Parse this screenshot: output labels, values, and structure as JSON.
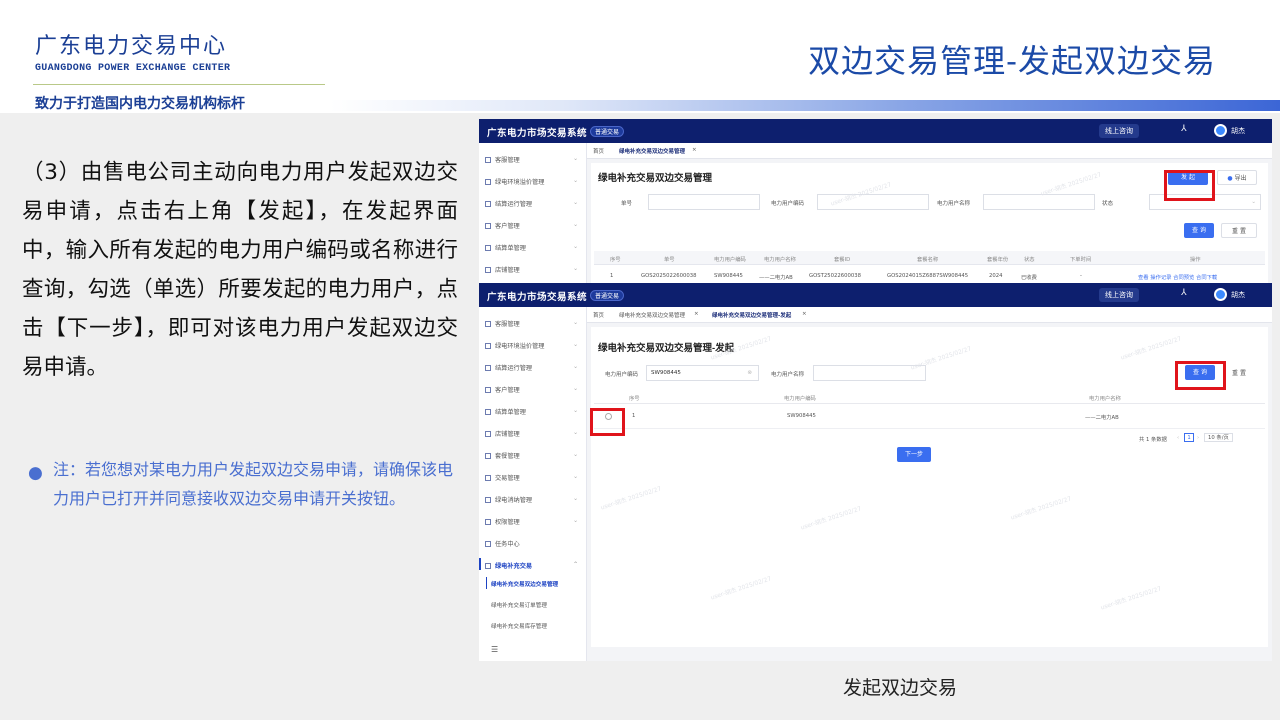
{
  "header": {
    "org_name": "广东电力交易中心",
    "org_name_en": "GUANGDONG POWER EXCHANGE CENTER",
    "slogan": "致力于打造国内电力交易机构标杆",
    "slide_title": "双边交易管理-发起双边交易"
  },
  "left": {
    "paragraph": "（3）由售电公司主动向电力用户发起双边交易申请，点击右上角【发起】，在发起界面中，输入所有发起的电力用户编码或名称进行查询，勾选（单选）所要发起的电力用户，点击【下一步】，即可对该电力用户发起双边交易申请。",
    "note": "注：若您想对某电力用户发起双边交易申请，请确保该电力用户已打开并同意接收双边交易申请开关按钮。"
  },
  "caption": "发起双边交易",
  "app": {
    "brand": "广东电力市场交易系统",
    "badge": "普通交易",
    "online": "线上咨询",
    "user": "胡杰",
    "watermark": "user-胡杰 2025/02/27",
    "sidebar1": [
      "客服管理",
      "绿电环境溢价管理",
      "结算运行管理",
      "客户管理",
      "结算单管理",
      "店铺管理"
    ],
    "sidebar2": [
      "客服管理",
      "绿电环境溢价管理",
      "结算运行管理",
      "客户管理",
      "结算单管理",
      "店铺管理",
      "套餐管理",
      "交易管理",
      "绿电消纳管理",
      "权限管理",
      "任务中心",
      "绿电补充交易"
    ],
    "sidebar2_sub": [
      "绿电补充交易双边交易管理",
      "绿电补充交易订单管理",
      "绿电补充交易库存管理"
    ],
    "shot1": {
      "tab_home": "首页",
      "tab_active": "绿电补充交易双边交易管理",
      "title": "绿电补充交易双边交易管理",
      "btn_initiate": "发 起",
      "btn_export": "导出",
      "labels": [
        "单号",
        "电力用户编码",
        "电力用户名称",
        "状态"
      ],
      "btn_query": "查 询",
      "btn_reset": "重 置",
      "columns": [
        "序号",
        "单号",
        "电力用户编码",
        "电力用户名称",
        "套餐ID",
        "套餐名称",
        "套餐年份",
        "状态",
        "下单时间",
        "操作"
      ],
      "row": [
        "1",
        "GOS2025022600038",
        "SW908445",
        "——二电力AB",
        "GOST25022600038",
        "GOS2024015Z6887SW908445",
        "2024",
        "已收费",
        "-",
        "查看  操作记录  合同预览  合同下载"
      ]
    },
    "shot2": {
      "tab_home": "首页",
      "tab_prev": "绿电补充交易双边交易管理",
      "tab_active": "绿电补充交易双边交易管理-发起",
      "title": "绿电补充交易双边交易管理-发起",
      "label_code": "电力用户编码",
      "input_code": "SW908445",
      "label_name": "电力用户名称",
      "btn_query": "查 询",
      "btn_reset": "重 置",
      "columns": [
        "序号",
        "电力用户编码",
        "电力用户名称"
      ],
      "row": [
        "1",
        "SW908445",
        "——二电力AB"
      ],
      "pager_total": "共 1 条数据",
      "pager_page": "1",
      "pager_size": "10 条/页",
      "btn_next": "下一步",
      "collapse_icon": "☰"
    }
  }
}
